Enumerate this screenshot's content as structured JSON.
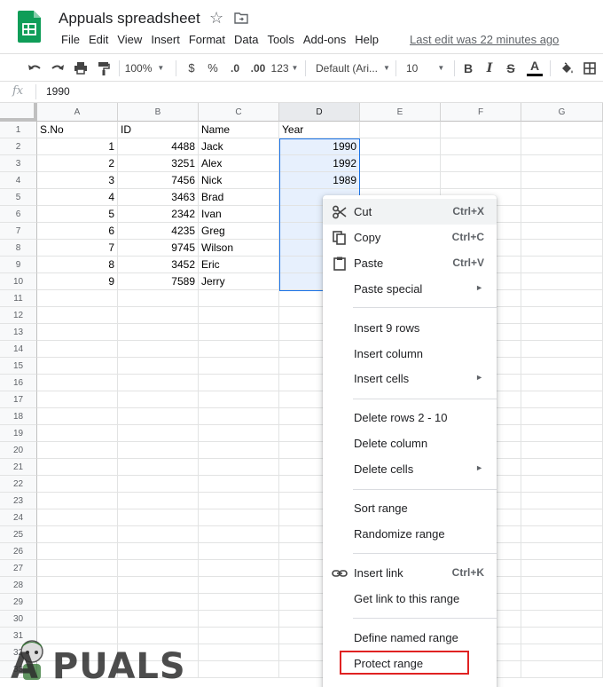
{
  "app": {
    "title": "Appuals spreadsheet",
    "last_edit": "Last edit was 22 minutes ago",
    "menu": [
      "File",
      "Edit",
      "View",
      "Insert",
      "Format",
      "Data",
      "Tools",
      "Add-ons",
      "Help"
    ]
  },
  "toolbar": {
    "zoom": "100%",
    "currency": "$",
    "percent": "%",
    "decrease_decimal": ".0",
    "increase_decimal": ".00",
    "more_formats": "123",
    "font": "Default (Ari...",
    "font_size": "10",
    "bold": "B",
    "italic": "I",
    "strikethrough": "S",
    "text_color": "A",
    "text_color_value": "#000000"
  },
  "formula_bar": {
    "fx": "fx",
    "value": "1990"
  },
  "grid": {
    "columns": [
      "A",
      "B",
      "C",
      "D",
      "E",
      "F",
      "G"
    ],
    "selected_column": "D",
    "row_numbers": [
      "1",
      "2",
      "3",
      "4",
      "5",
      "6",
      "7",
      "8",
      "9",
      "10",
      "11",
      "12",
      "13",
      "14",
      "15",
      "16",
      "17",
      "18",
      "19",
      "20",
      "21",
      "22",
      "23",
      "24",
      "25",
      "26",
      "27",
      "28",
      "29",
      "30",
      "31",
      "32",
      "33"
    ],
    "headers": [
      "S.No",
      "ID",
      "Name",
      "Year"
    ],
    "rows": [
      {
        "sno": "1",
        "id": "4488",
        "name": "Jack",
        "year": "1990"
      },
      {
        "sno": "2",
        "id": "3251",
        "name": "Alex",
        "year": "1992"
      },
      {
        "sno": "3",
        "id": "7456",
        "name": "Nick",
        "year": "1989"
      },
      {
        "sno": "4",
        "id": "3463",
        "name": "Brad",
        "year": ""
      },
      {
        "sno": "5",
        "id": "2342",
        "name": "Ivan",
        "year": ""
      },
      {
        "sno": "6",
        "id": "4235",
        "name": "Greg",
        "year": ""
      },
      {
        "sno": "7",
        "id": "9745",
        "name": "Wilson",
        "year": ""
      },
      {
        "sno": "8",
        "id": "3452",
        "name": "Eric",
        "year": ""
      },
      {
        "sno": "9",
        "id": "7589",
        "name": "Jerry",
        "year": ""
      }
    ]
  },
  "context_menu": {
    "cut": {
      "label": "Cut",
      "shortcut": "Ctrl+X"
    },
    "copy": {
      "label": "Copy",
      "shortcut": "Ctrl+C"
    },
    "paste": {
      "label": "Paste",
      "shortcut": "Ctrl+V"
    },
    "paste_special": {
      "label": "Paste special"
    },
    "insert_rows": {
      "label": "Insert 9 rows"
    },
    "insert_column": {
      "label": "Insert column"
    },
    "insert_cells": {
      "label": "Insert cells"
    },
    "delete_rows": {
      "label": "Delete rows 2 - 10"
    },
    "delete_column": {
      "label": "Delete column"
    },
    "delete_cells": {
      "label": "Delete cells"
    },
    "sort_range": {
      "label": "Sort range"
    },
    "randomize_range": {
      "label": "Randomize range"
    },
    "insert_link": {
      "label": "Insert link",
      "shortcut": "Ctrl+K"
    },
    "get_link": {
      "label": "Get link to this range"
    },
    "define_named_range": {
      "label": "Define named range"
    },
    "protect_range": {
      "label": "Protect range"
    },
    "submenu_arrow": "►"
  },
  "watermark": {
    "text": "A PUALS"
  },
  "colors": {
    "selection": "#1a73e8",
    "selection_fill": "#e7f0fd",
    "highlight": "#e02222",
    "sheets_green": "#0f9d58"
  }
}
